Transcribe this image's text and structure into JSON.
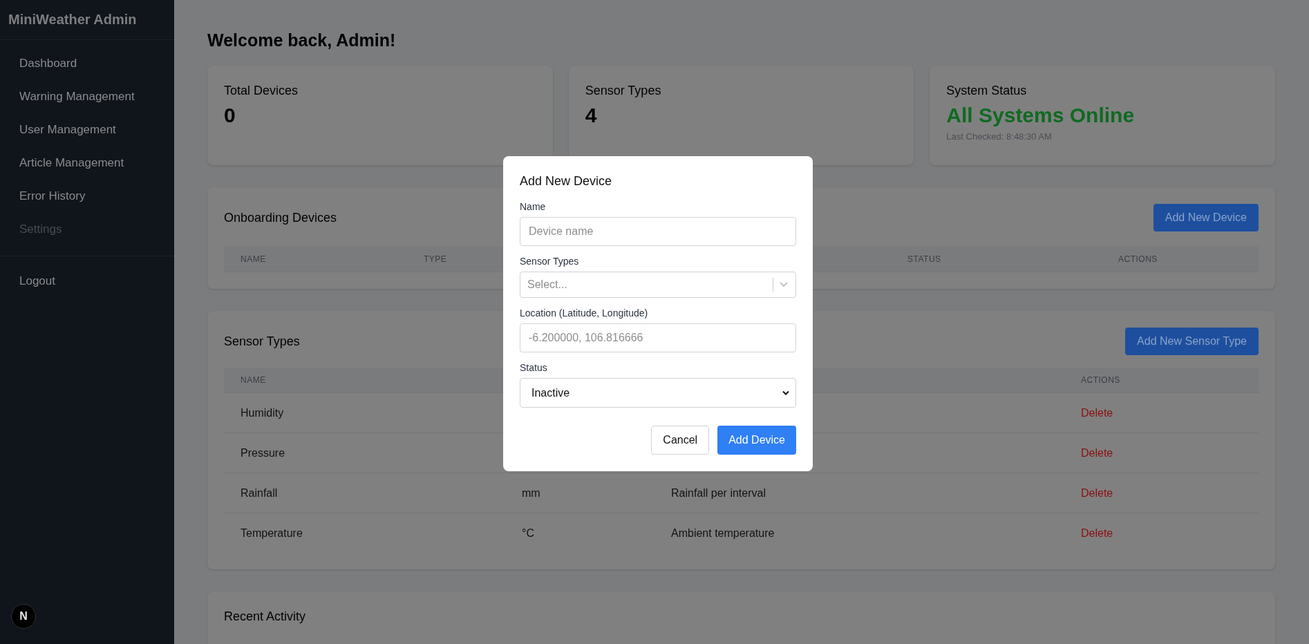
{
  "sidebar": {
    "title": "MiniWeather Admin",
    "items": [
      {
        "label": "Dashboard",
        "disabled": false
      },
      {
        "label": "Warning Management",
        "disabled": false
      },
      {
        "label": "User Management",
        "disabled": false
      },
      {
        "label": "Article Management",
        "disabled": false
      },
      {
        "label": "Error History",
        "disabled": false
      },
      {
        "label": "Settings",
        "disabled": true
      }
    ],
    "logout": "Logout",
    "dev_badge": "N"
  },
  "heading": "Welcome back, Admin!",
  "stats": [
    {
      "kind": "count",
      "label": "Total Devices",
      "value": "0"
    },
    {
      "kind": "count",
      "label": "Sensor Types",
      "value": "4"
    },
    {
      "kind": "status",
      "label": "System Status",
      "value": "All Systems Online",
      "note": "Last Checked: 8:48:30 AM"
    }
  ],
  "onboarding": {
    "title": "Onboarding Devices",
    "button": "Add New Device",
    "columns": [
      {
        "label": "NAME"
      },
      {
        "label": "TYPE"
      },
      {},
      {
        "label": "STATUS"
      },
      {
        "label": "ACTIONS"
      }
    ]
  },
  "sensor_types": {
    "title": "Sensor Types",
    "button": "Add New Sensor Type",
    "columns": [
      {
        "label": "NAME"
      },
      {},
      {},
      {
        "label": "ACTIONS"
      }
    ],
    "rows": [
      {
        "name": "Humidity",
        "action": "Delete"
      },
      {
        "name": "Pressure",
        "action": "Delete"
      },
      {
        "name": "Rainfall",
        "unit": "mm",
        "description": "Rainfall per interval",
        "action": "Delete"
      },
      {
        "name": "Temperature",
        "unit": "°C",
        "description": "Ambient temperature",
        "action": "Delete"
      }
    ]
  },
  "recent_activity": {
    "title": "Recent Activity"
  },
  "modal": {
    "title": "Add New Device",
    "fields": [
      {
        "kind": "text",
        "label": "Name",
        "placeholder": "Device name"
      },
      {
        "kind": "multiselect",
        "label": "Sensor Types",
        "placeholder": "Select..."
      },
      {
        "kind": "text",
        "label": "Location (Latitude, Longitude)",
        "placeholder": "-6.200000, 106.816666"
      },
      {
        "kind": "select",
        "label": "Status",
        "value": "Inactive"
      }
    ],
    "cancel": "Cancel",
    "submit": "Add Device"
  }
}
